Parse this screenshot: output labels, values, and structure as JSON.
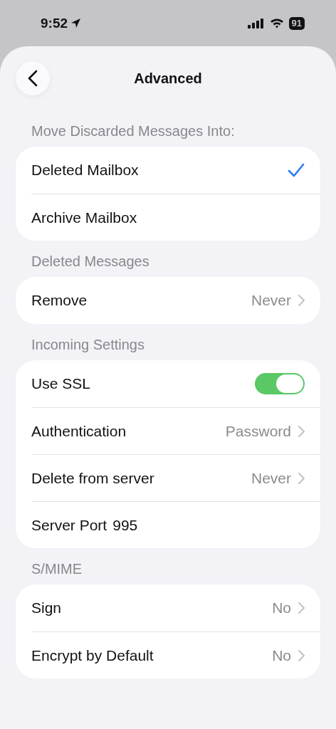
{
  "status_bar": {
    "time": "9:52",
    "battery": "91"
  },
  "nav": {
    "title": "Advanced"
  },
  "sections": [
    {
      "header": "Move Discarded Messages Into:",
      "rows": [
        {
          "kind": "choice",
          "label": "Deleted Mailbox",
          "selected": true
        },
        {
          "kind": "choice",
          "label": "Archive Mailbox",
          "selected": false
        }
      ]
    },
    {
      "header": "Deleted Messages",
      "rows": [
        {
          "kind": "link",
          "label": "Remove",
          "value": "Never"
        }
      ]
    },
    {
      "header": "Incoming Settings",
      "rows": [
        {
          "kind": "toggle",
          "label": "Use SSL",
          "on": true
        },
        {
          "kind": "link",
          "label": "Authentication",
          "value": "Password"
        },
        {
          "kind": "link",
          "label": "Delete from server",
          "value": "Never"
        },
        {
          "kind": "field",
          "label": "Server Port",
          "value": "995"
        }
      ]
    },
    {
      "header": "S/MIME",
      "rows": [
        {
          "kind": "link",
          "label": "Sign",
          "value": "No"
        },
        {
          "kind": "link",
          "label": "Encrypt by Default",
          "value": "No"
        }
      ]
    }
  ]
}
